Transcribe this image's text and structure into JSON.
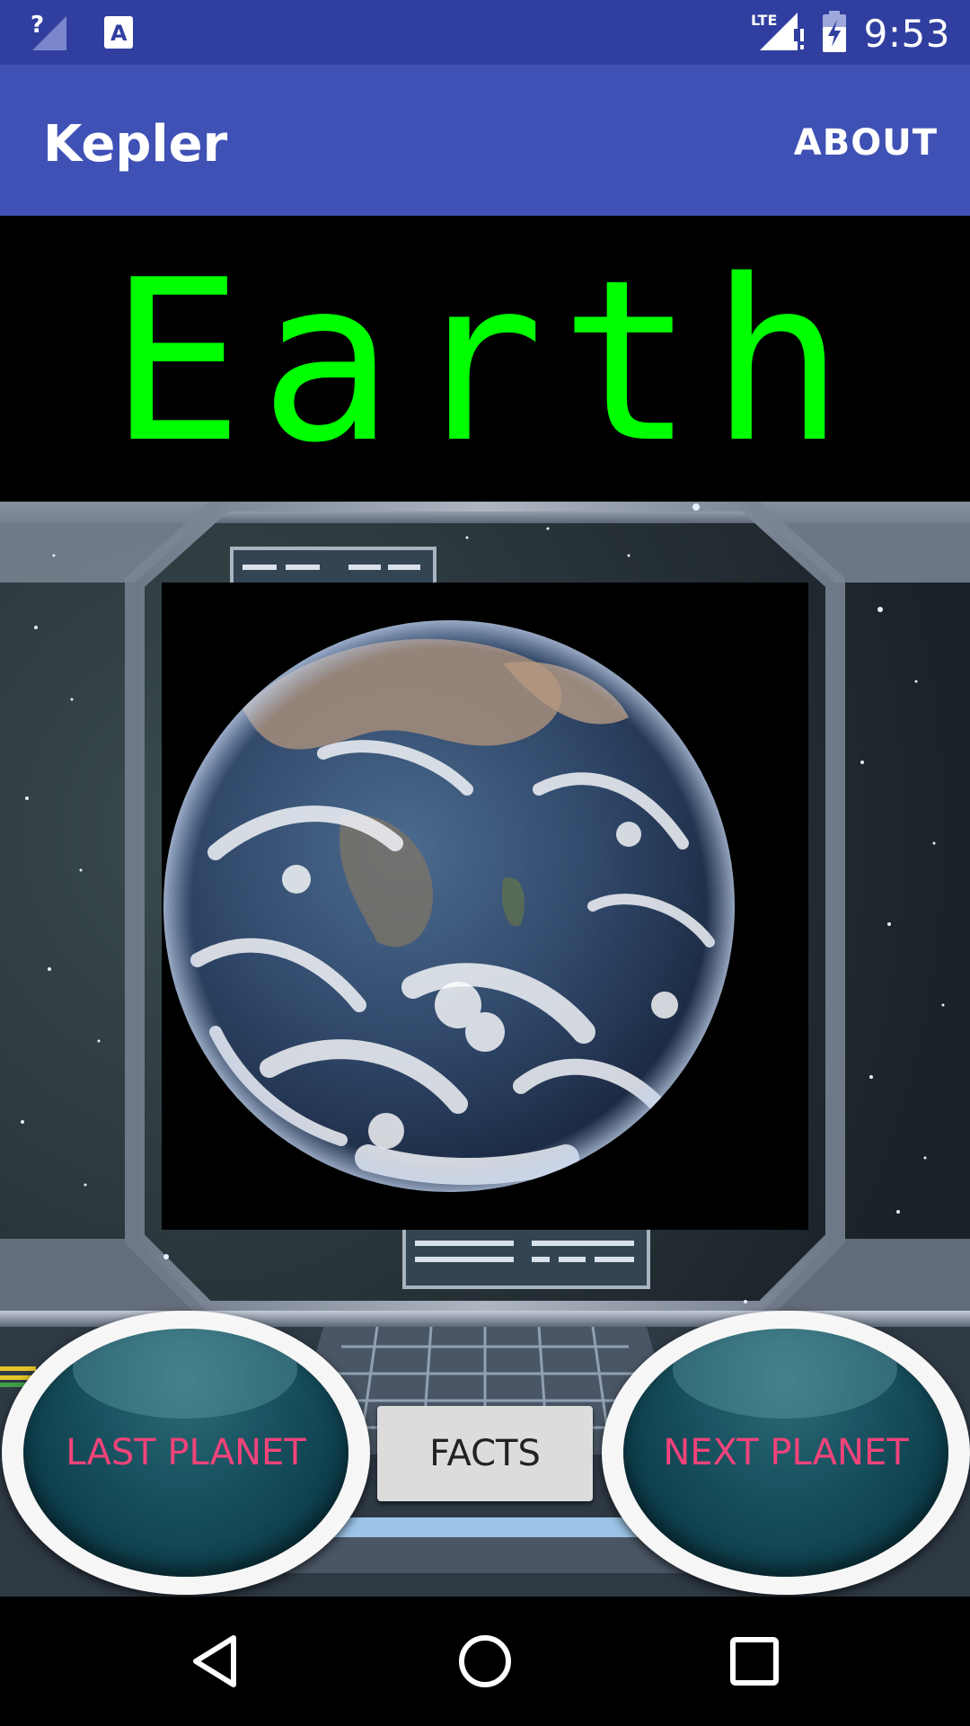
{
  "status_bar": {
    "time": "9:53",
    "network_label": "LTE",
    "icons": [
      "signal-unknown-icon",
      "keyboard-a-icon",
      "lte-signal-icon",
      "battery-charging-icon"
    ]
  },
  "app_bar": {
    "title": "Kepler",
    "about_label": "ABOUT"
  },
  "planet": {
    "name": "Earth",
    "name_color": "#00FF00"
  },
  "controls": {
    "last_label": "LAST PLANET",
    "facts_label": "FACTS",
    "next_label": "NEXT PLANET",
    "accent_color": "#F2437A"
  },
  "nav_bar": {
    "icons": [
      "back-icon",
      "home-icon",
      "recents-icon"
    ]
  }
}
